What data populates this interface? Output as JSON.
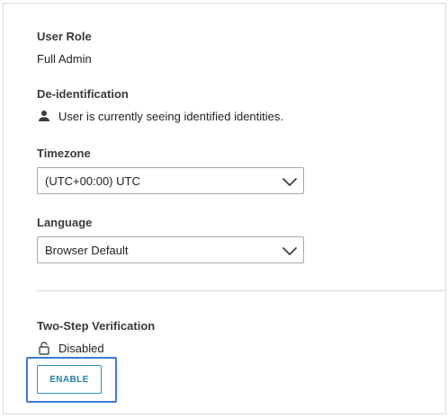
{
  "user_role": {
    "label": "User Role",
    "value": "Full Admin"
  },
  "deidentification": {
    "label": "De-identification",
    "icon": "person-icon",
    "status_text": "User is currently seeing identified identities."
  },
  "timezone": {
    "label": "Timezone",
    "selected": "(UTC+00:00) UTC",
    "icon": "chevron-down-icon"
  },
  "language": {
    "label": "Language",
    "selected": "Browser Default",
    "icon": "chevron-down-icon"
  },
  "two_step": {
    "label": "Two-Step Verification",
    "icon": "unlocked-lock-icon",
    "status": "Disabled",
    "button_label": "ENABLE"
  },
  "colors": {
    "button_text": "#1f7fae",
    "button_border": "#2b8fbf",
    "focus_ring": "#3a7bd5",
    "label_text": "#3a3a3a"
  }
}
